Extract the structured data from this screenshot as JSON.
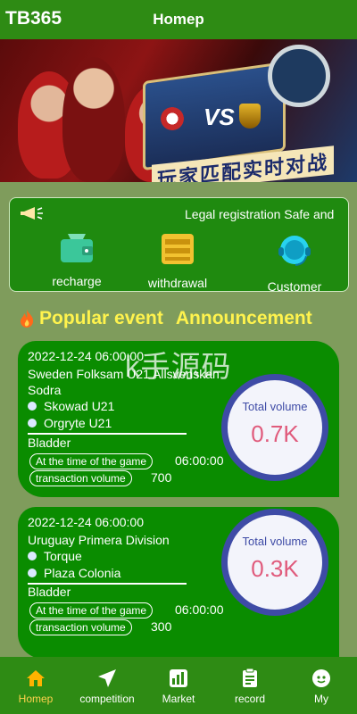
{
  "header": {
    "brand": "TB365",
    "title": "Homep"
  },
  "banner": {
    "caption": "玩家匹配实时对战",
    "vs": "VS"
  },
  "notice": {
    "marquee": "Legal registration Safe and"
  },
  "actions": [
    {
      "label": "recharge",
      "icon": "wallet-icon"
    },
    {
      "label": "withdrawal",
      "icon": "cards-icon"
    },
    {
      "label": "Customer",
      "icon": "headset-icon"
    }
  ],
  "section": {
    "popular": "Popular event",
    "announcement": "Announcement"
  },
  "watermark": "k手源码",
  "events": [
    {
      "date": "2022-12-24 06:00:00",
      "league": "Sweden Folksam U21 Allsvenskan Sodra",
      "team_a": "Skowad U21",
      "team_b": "Orgryte U21",
      "bet_type": "Bladder",
      "time_label": "At the time of the game",
      "time_value": "06:00:00",
      "volume_label": "transaction volume",
      "volume_value": "700",
      "total_label": "Total volume",
      "total_value": "0.7K"
    },
    {
      "date": "2022-12-24 06:00:00",
      "league": "Uruguay Primera Division",
      "team_a": "Torque",
      "team_b": "Plaza Colonia",
      "bet_type": "Bladder",
      "time_label": "At the time of the game",
      "time_value": "06:00:00",
      "volume_label": "transaction volume",
      "volume_value": "300",
      "total_label": "Total volume",
      "total_value": "0.3K"
    }
  ],
  "nav": [
    {
      "label": "Homep",
      "icon": "home-icon",
      "active": true
    },
    {
      "label": "competition",
      "icon": "send-icon",
      "active": false
    },
    {
      "label": "Market",
      "icon": "market-icon",
      "active": false
    },
    {
      "label": "record",
      "icon": "clipboard-icon",
      "active": false
    },
    {
      "label": "My",
      "icon": "face-icon",
      "active": false
    }
  ],
  "colors": {
    "accent": "#2e8b14",
    "highlight": "#fff34d",
    "volume": "#e05b7c",
    "ring": "#3e4ba6"
  }
}
